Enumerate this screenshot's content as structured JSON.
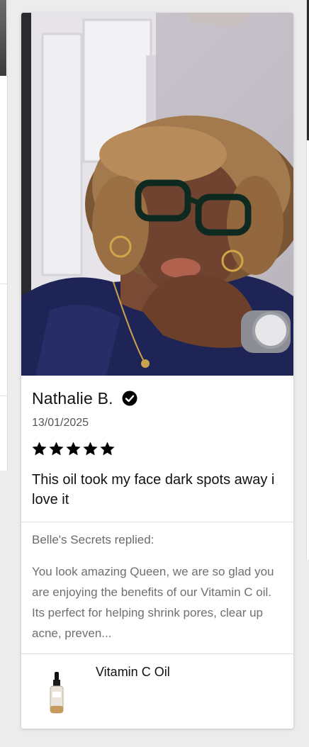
{
  "review": {
    "reviewer_name": "Nathalie B.",
    "verified": true,
    "date": "13/01/2025",
    "rating": 5,
    "rating_max": 5,
    "text": "This oil took my face dark spots away i love it",
    "photo_icon": "reviewer-photo"
  },
  "reply": {
    "heading": "Belle's Secrets replied:",
    "text": "You look amazing Queen, we are so glad you are enjoying the benefits of our Vitamin C oil. Its perfect for helping shrink pores, clear up acne, preven..."
  },
  "product": {
    "name": "Vitamin C Oil",
    "thumbnail_icon": "serum-bottle-icon"
  },
  "colors": {
    "star": "#000000",
    "verified_badge": "#000000",
    "card_background": "#ffffff",
    "page_background": "#ececec"
  }
}
